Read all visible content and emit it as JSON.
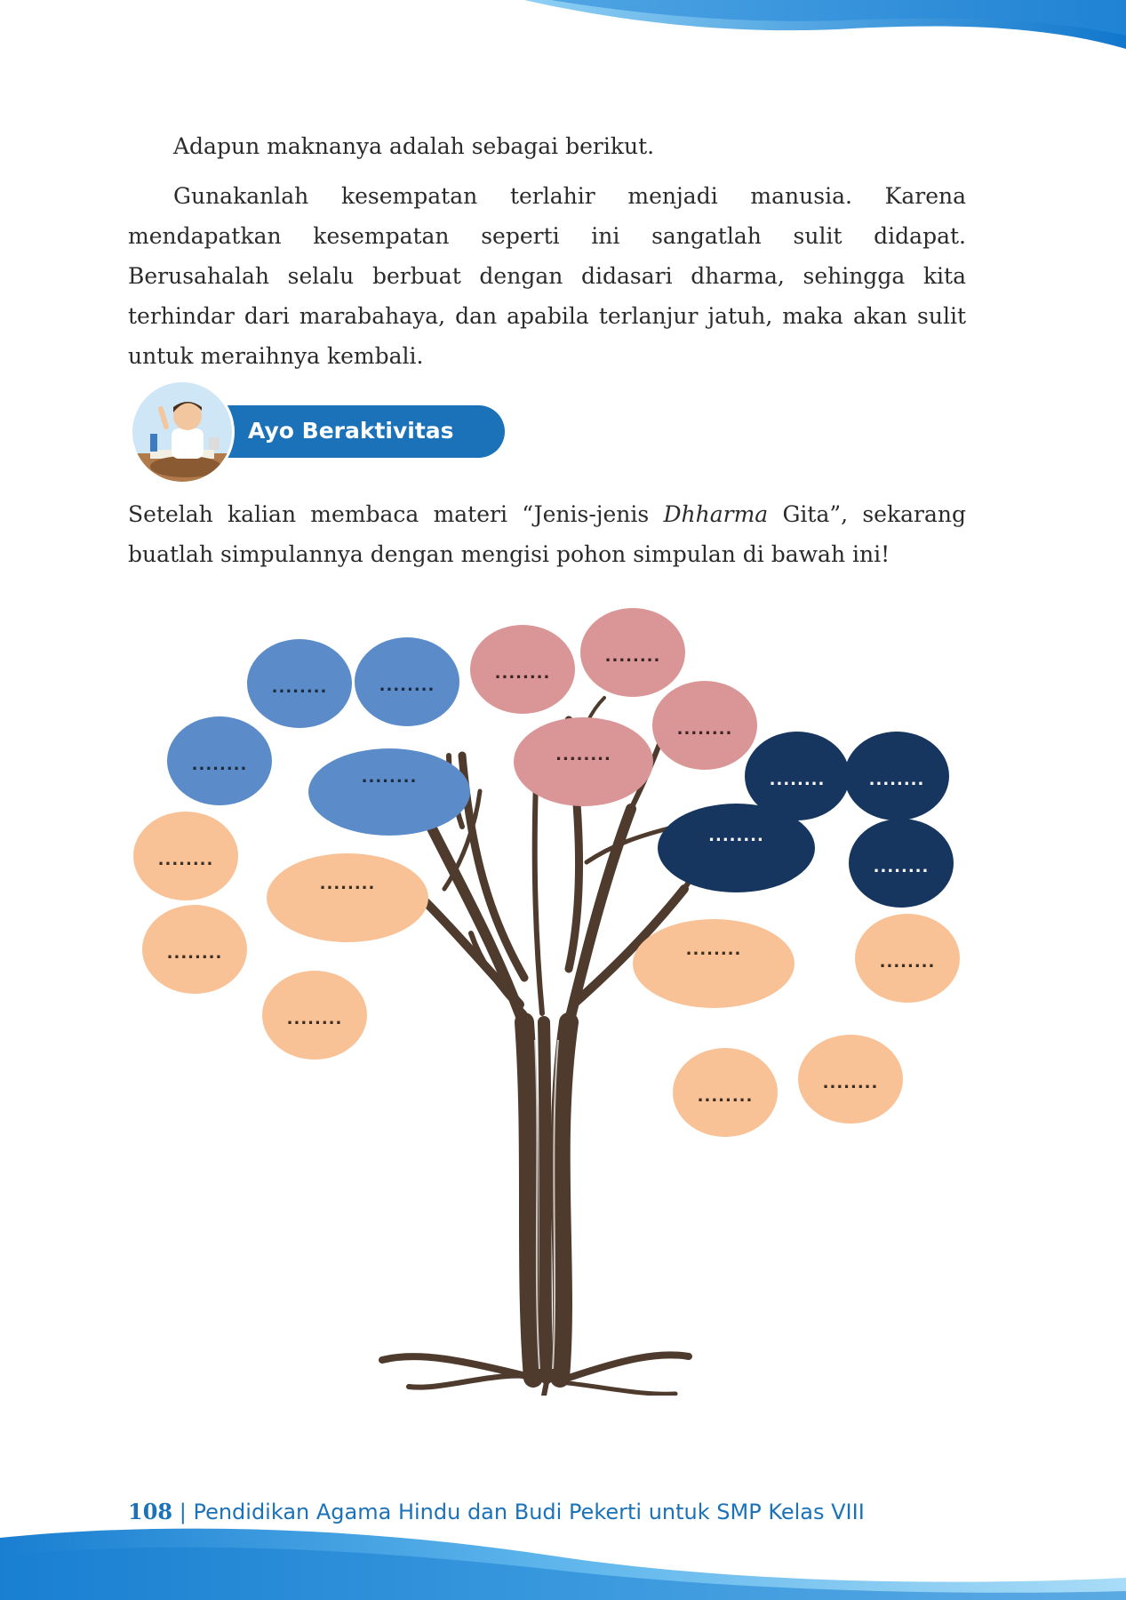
{
  "paragraphs": {
    "intro": "Adapun maknanya adalah sebagai berikut.",
    "meaning": "Gunakanlah kesempatan terlahir menjadi manusia. Karena mendapatkan kesempatan seperti ini sangatlah sulit didapat. Berusahalah selalu berbuat dengan didasari dharma, sehingga kita terhindar dari marabahaya, dan apabila terlanjur jatuh, maka akan sulit untuk meraihnya kembali."
  },
  "activity": {
    "label": "Ayo Beraktivitas"
  },
  "instruction": {
    "before": "Setelah kalian membaca materi “Jenis-jenis ",
    "italic": "Dhharma",
    "after": " Gita”, sekarang buatlah simpulannya dengan mengisi pohon simpulan di bawah ini!"
  },
  "tree": {
    "placeholder": "........",
    "colors": {
      "blue": "#5b8cc9",
      "pink": "#da9697",
      "navy": "#16355f",
      "peach": "#f8c296"
    }
  },
  "footer": {
    "page_number": "108",
    "separator": " | ",
    "book_title": "Pendidikan Agama Hindu dan Budi Pekerti untuk SMP Kelas VIII"
  }
}
